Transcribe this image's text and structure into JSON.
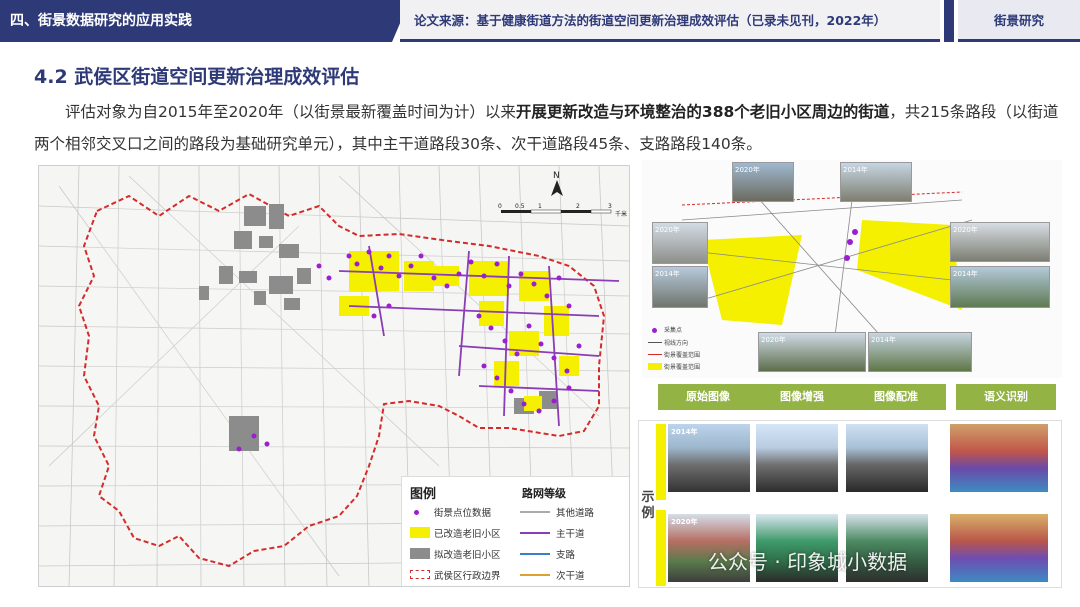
{
  "header": {
    "left": "四、街景数据研究的应用实践",
    "middle": "论文来源：基于健康街道方法的街道空间更新治理成效评估（已录未见刊，2022年）",
    "right": "街景研究"
  },
  "section_title": "4.2 武侯区街道空间更新治理成效评估",
  "paragraph": {
    "line_a": "评估对象为自2015年至2020年（以街景最新覆盖时间为计）以来",
    "bold": "开展更新改造与环境整治的388个老旧小区周边的街道",
    "line_b": "，共215条路段（以街道两个相邻交叉口之间的路段为基础研究单元），其中主干道路段30条、次干道路段45条、支路路段140条。"
  },
  "map": {
    "north": "N",
    "scale_ticks": [
      "0",
      "0.5",
      "1",
      "2",
      "3"
    ],
    "scale_unit": "千米",
    "legend": {
      "title": "图例",
      "subtitle": "路网等级",
      "items": [
        {
          "label": "街景点位数据"
        },
        {
          "label": "已改造老旧小区"
        },
        {
          "label": "拟改造老旧小区"
        },
        {
          "label": "武侯区行政边界"
        }
      ],
      "roads": [
        {
          "label": "其他道路",
          "color": "#aaaaaa"
        },
        {
          "label": "主干道",
          "color": "#8a3db5"
        },
        {
          "label": "支路",
          "color": "#3a7fc8"
        },
        {
          "label": "次干道",
          "color": "#e0a030"
        }
      ]
    }
  },
  "diagram": {
    "photo_labels": [
      "2020年",
      "2014年",
      "2020年",
      "2014年",
      "2020年",
      "2014年",
      "2020年",
      "2014年"
    ],
    "legend": [
      "采集点",
      "视线方向",
      "街景覆盖范围",
      "街景覆盖范围"
    ]
  },
  "process": {
    "tabs": [
      "原始图像",
      "图像增强",
      "图像配准",
      "语义识别"
    ],
    "side_label": "示例",
    "years": [
      "2014年",
      "2020年"
    ]
  },
  "watermark": "公众号 · 印象城小数据",
  "colors": {
    "navy": "#2e3a78",
    "tab_green": "#93b344",
    "boundary_red": "#d42b2b",
    "renovated_yellow": "#f4f000",
    "planned_gray": "#8c8c8c",
    "point_purple": "#9b1fd0"
  }
}
